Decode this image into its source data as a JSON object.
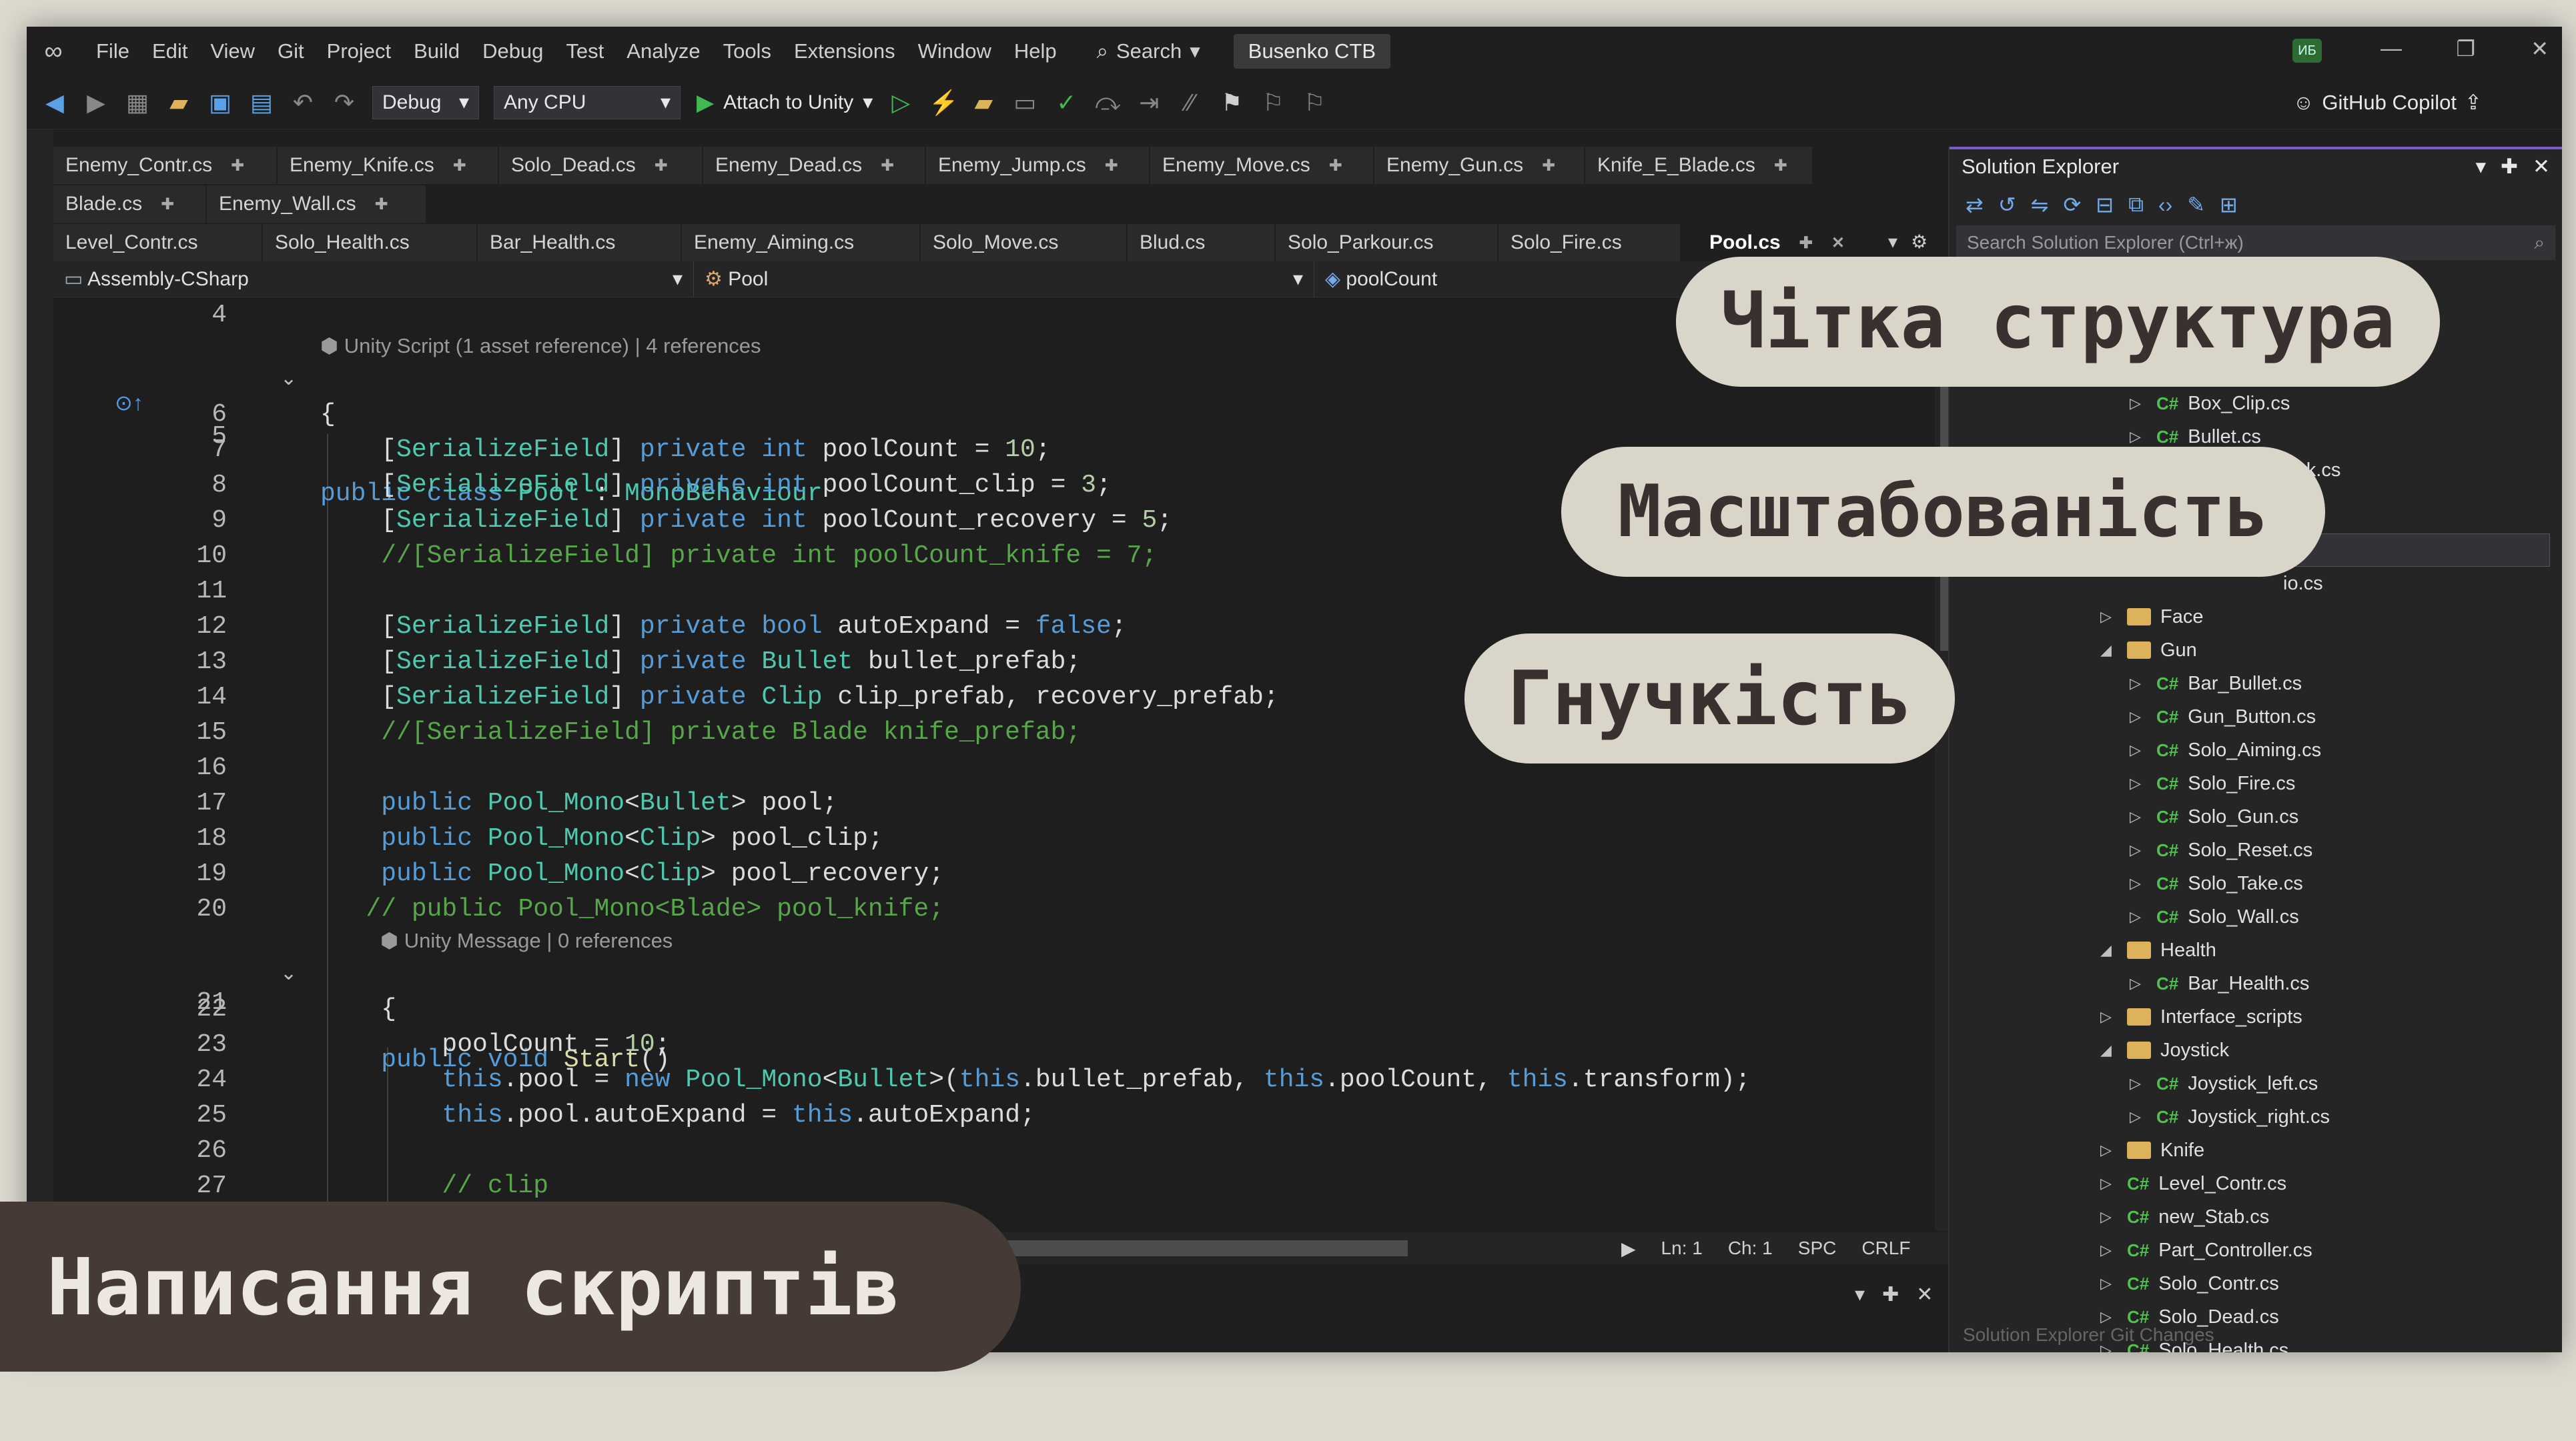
{
  "menu": [
    "File",
    "Edit",
    "View",
    "Git",
    "Project",
    "Build",
    "Debug",
    "Test",
    "Analyze",
    "Tools",
    "Extensions",
    "Window",
    "Help"
  ],
  "search_label": "Search",
  "solution_name": "Busenko CTB",
  "avatar_initials": "ИБ",
  "toolbar": {
    "config": "Debug",
    "platform": "Any CPU",
    "attach_label": "Attach to Unity",
    "copilot_label": "GitHub Copilot"
  },
  "tabs_row1": [
    "Enemy_Contr.cs",
    "Enemy_Knife.cs",
    "Solo_Dead.cs",
    "Enemy_Dead.cs",
    "Enemy_Jump.cs",
    "Enemy_Move.cs",
    "Enemy_Gun.cs",
    "Knife_E_Blade.cs"
  ],
  "tabs_row2": [
    "Blade.cs",
    "Enemy_Wall.cs"
  ],
  "tabs_row3": [
    "Level_Contr.cs",
    "Solo_Health.cs",
    "Bar_Health.cs",
    "Enemy_Aiming.cs",
    "Solo_Move.cs",
    "Blud.cs",
    "Solo_Parkour.cs",
    "Solo_Fire.cs"
  ],
  "active_tab": "Pool.cs",
  "navbar": {
    "project": "Assembly-CSharp",
    "class": "Pool",
    "member": "poolCount"
  },
  "code_hints": {
    "class_hint": "Unity Script (1 asset reference) | 4 references",
    "method_hint": "Unity Message | 0 references"
  },
  "line_numbers": [
    "4",
    "5",
    "6",
    "7",
    "8",
    "9",
    "10",
    "11",
    "12",
    "13",
    "14",
    "15",
    "16",
    "17",
    "18",
    "19",
    "20",
    "21",
    "22",
    "23",
    "24",
    "25",
    "26",
    "27"
  ],
  "status": {
    "line": "Ln: 1",
    "col": "Ch: 1",
    "spacing": "SPC",
    "eol": "CRLF"
  },
  "solution_explorer": {
    "title": "Solution Explorer",
    "search_placeholder": "Search Solution Explorer (Ctrl+ж)",
    "items": [
      {
        "label": "Box_Clip.cs",
        "kind": "cs"
      },
      {
        "label": "Bullet.cs",
        "kind": "cs"
      },
      {
        "label": "Mask.cs",
        "kind": "cs"
      },
      {
        "label": "io.cs",
        "kind": "cs"
      },
      {
        "label": "Face",
        "kind": "folder"
      },
      {
        "label": "Gun",
        "kind": "folder"
      },
      {
        "label": "Bar_Bullet.cs",
        "kind": "cs"
      },
      {
        "label": "Gun_Button.cs",
        "kind": "cs"
      },
      {
        "label": "Solo_Aiming.cs",
        "kind": "cs"
      },
      {
        "label": "Solo_Fire.cs",
        "kind": "cs"
      },
      {
        "label": "Solo_Gun.cs",
        "kind": "cs"
      },
      {
        "label": "Solo_Reset.cs",
        "kind": "cs"
      },
      {
        "label": "Solo_Take.cs",
        "kind": "cs"
      },
      {
        "label": "Solo_Wall.cs",
        "kind": "cs"
      },
      {
        "label": "Health",
        "kind": "folder"
      },
      {
        "label": "Bar_Health.cs",
        "kind": "cs"
      },
      {
        "label": "Interface_scripts",
        "kind": "folder"
      },
      {
        "label": "Joystick",
        "kind": "folder"
      },
      {
        "label": "Joystick_left.cs",
        "kind": "cs"
      },
      {
        "label": "Joystick_right.cs",
        "kind": "cs"
      },
      {
        "label": "Knife",
        "kind": "folder"
      },
      {
        "label": "Level_Contr.cs",
        "kind": "cs"
      },
      {
        "label": "new_Stab.cs",
        "kind": "cs"
      },
      {
        "label": "Part_Controller.cs",
        "kind": "cs"
      },
      {
        "label": "Solo_Contr.cs",
        "kind": "cs"
      },
      {
        "label": "Solo_Dead.cs",
        "kind": "cs"
      },
      {
        "label": "Solo_Health.cs",
        "kind": "cs"
      }
    ],
    "footer": "Solution Explorer   Git Changes"
  },
  "overlay": {
    "pill1": "Чітка структура",
    "pill2": "Масштабованість",
    "pill3": "Гнучкість",
    "banner": "Написання скриптів"
  },
  "colors": {
    "background": "#dcd9cf",
    "pill": "#d9d5c8",
    "banner": "#453a35",
    "editor": "#1e1e1e",
    "keyword": "#569cd6",
    "type": "#4ec9b0",
    "comment": "#57a64a"
  }
}
